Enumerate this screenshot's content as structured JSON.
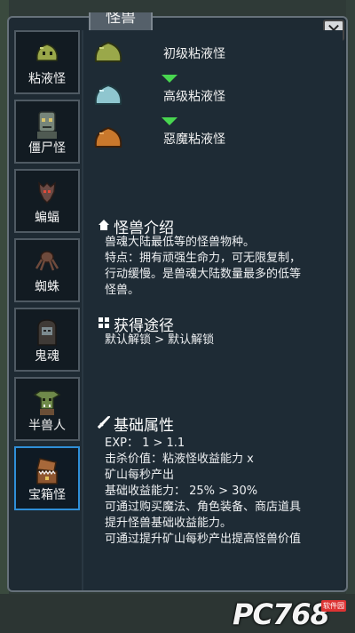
{
  "window": {
    "title": "怪兽",
    "close_label": "✕"
  },
  "sidebar": {
    "items": [
      {
        "label": "粘液怪",
        "icon": "slime-icon",
        "active": false
      },
      {
        "label": "僵尸怪",
        "icon": "zombie-icon",
        "active": false
      },
      {
        "label": "蝙蝠",
        "icon": "bat-icon",
        "active": false
      },
      {
        "label": "蜘蛛",
        "icon": "spider-icon",
        "active": false
      },
      {
        "label": "鬼魂",
        "icon": "ghost-icon",
        "active": false
      },
      {
        "label": "半兽人",
        "icon": "orc-icon",
        "active": false
      },
      {
        "label": "宝箱怪",
        "icon": "mimic-icon",
        "active": true
      }
    ]
  },
  "evolution": {
    "stages": [
      {
        "name": "初级粘液怪",
        "color": "#9aa84a"
      },
      {
        "name": "高级粘液怪",
        "color": "#8fc6cf"
      },
      {
        "name": "惡魔粘液怪",
        "color": "#c9782c"
      }
    ]
  },
  "intro": {
    "title": "怪兽介绍",
    "lines": [
      "兽魂大陆最低等的怪兽物种。",
      "特点：拥有顽强生命力，可无限复制，",
      "行动缓慢。是兽魂大陆数量最多的低等",
      "怪兽。"
    ]
  },
  "obtain": {
    "title": "获得途径",
    "text": "默认解锁 > 默认解锁"
  },
  "attributes": {
    "title": "基础属性",
    "lines": [
      "EXP： 1 > 1.1",
      "击杀价值：粘液怪收益能力 x",
      "矿山每秒产出",
      "基础收益能力： 25% > 30%",
      "可通过购买魔法、角色装备、商店道具",
      "提升怪兽基础收益能力。",
      "可通过提升矿山每秒产出提高怪兽价值"
    ]
  },
  "watermark": {
    "text": "PC768",
    "badge": "软件园"
  },
  "colors": {
    "dialog_bg": "#1e2a33",
    "active_border": "#2f8fd8",
    "arrow": "#48d650"
  }
}
